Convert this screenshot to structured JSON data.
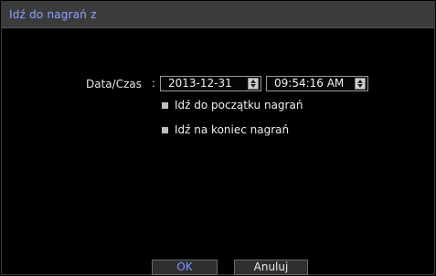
{
  "dialog": {
    "title": "Idź do nagrań z",
    "datetime": {
      "label": "Data/Czas",
      "separator": ":",
      "date_value": "2013-12-31",
      "time_value": "09:54:16 AM"
    },
    "options": [
      {
        "label": "Idź do początku nagrań"
      },
      {
        "label": "Idź na koniec nagrań"
      }
    ],
    "buttons": {
      "ok_label": "OK",
      "cancel_label": "Anuluj"
    }
  },
  "colors": {
    "title_text": "#8fa3ff",
    "ok_text": "#7f97ff",
    "background": "#000000",
    "titlebar": "#3b3b3b"
  }
}
